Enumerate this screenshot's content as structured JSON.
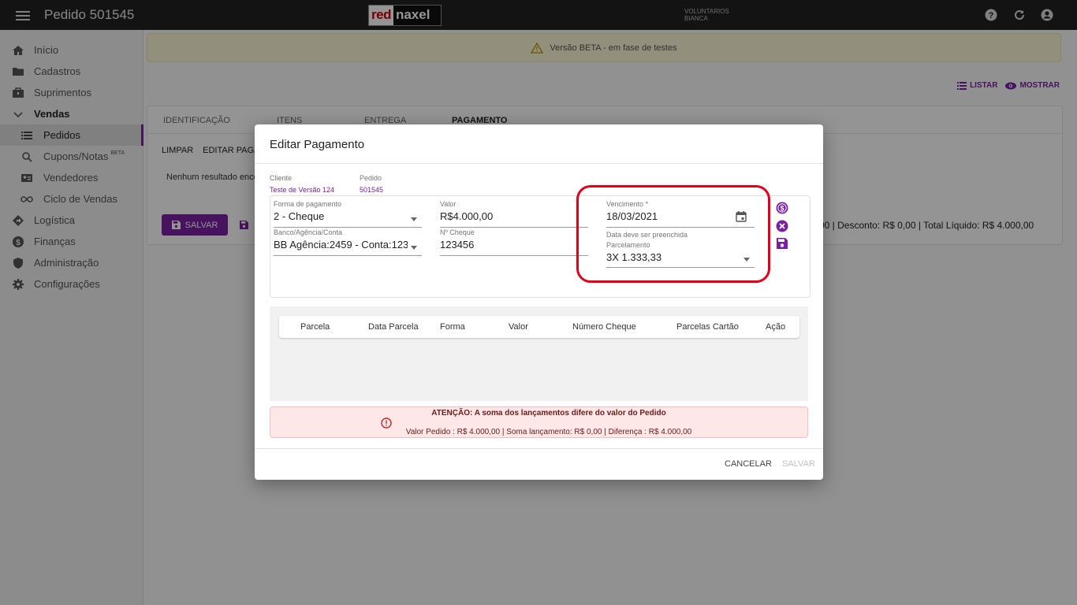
{
  "topbar": {
    "title": "Pedido 501545",
    "logo_red": "red",
    "logo_dark": "naxel",
    "org": "VOLUNTARIOS",
    "user": "BIANCA"
  },
  "sidebar": {
    "items": [
      {
        "label": "Início",
        "icon": "home-icon"
      },
      {
        "label": "Cadastros",
        "icon": "folder-icon"
      },
      {
        "label": "Suprimentos",
        "icon": "briefcase-icon"
      },
      {
        "label": "Vendas",
        "icon": "chevron-down-icon"
      },
      {
        "label": "Pedidos",
        "icon": "list-icon"
      },
      {
        "label": "Cupons/Notas",
        "icon": "receipt-search-icon",
        "badge": "BETA"
      },
      {
        "label": "Vendedores",
        "icon": "badge-icon"
      },
      {
        "label": "Ciclo de Vendas",
        "icon": "infinity-icon"
      },
      {
        "label": "Logística",
        "icon": "directions-icon"
      },
      {
        "label": "Finanças",
        "icon": "dollar-icon"
      },
      {
        "label": "Administração",
        "icon": "shield-icon"
      },
      {
        "label": "Configurações",
        "icon": "gear-icon"
      }
    ]
  },
  "main": {
    "beta_banner": "Versão BETA - em fase de testes",
    "listar": "LISTAR",
    "mostrar": "MOSTRAR",
    "tabs": [
      "IDENTIFICAÇÃO",
      "ITENS",
      "ENTREGA",
      "PAGAMENTO"
    ],
    "actions": [
      "LIMPAR",
      "EDITAR PAGA"
    ],
    "no_result": "Nenhum resultado enco",
    "salvar": "SALVAR",
    "totals": "00 | Desconto: R$ 0,00 | Total Líquido: R$ 4.000,00"
  },
  "modal": {
    "title": "Editar Pagamento",
    "cliente_label": "Cliente",
    "cliente_value": "Teste de Versão 124",
    "pedido_label": "Pedido",
    "pedido_value": "501545",
    "forma_label": "Forma de pagamento",
    "forma_value": "2 - Cheque",
    "valor_label": "Valor",
    "valor_value": "R$4.000,00",
    "vencimento_label": "Vencimento *",
    "vencimento_value": "18/03/2021",
    "vencimento_hint": "Data deve ser preenchida",
    "banco_label": "Banco/Agência/Conta",
    "banco_value": "BB Agência:2459 - Conta:123...",
    "cheque_label": "Nº Cheque",
    "cheque_value": "123456",
    "parcelamento_label": "Parcelamento",
    "parcelamento_value": "3X 1.333,33",
    "table_headers": [
      "Parcela",
      "Data Parcela",
      "Forma",
      "Valor",
      "Número Cheque",
      "Parcelas Cartão",
      "Ação"
    ],
    "alert_title": "ATENÇÃO: A soma dos lançamentos difere do valor do Pedido",
    "alert_msg": "Valor Pedido : R$ 4.000,00 | Soma lançamento: R$ 0,00 | Diferença : R$ 4.000,00",
    "cancel": "CANCELAR",
    "save": "SALVAR"
  },
  "colors": {
    "accent": "#7b1fa2",
    "topbar": "#212121",
    "highlight": "#e0001b",
    "alert_bg": "#fde7e7"
  }
}
